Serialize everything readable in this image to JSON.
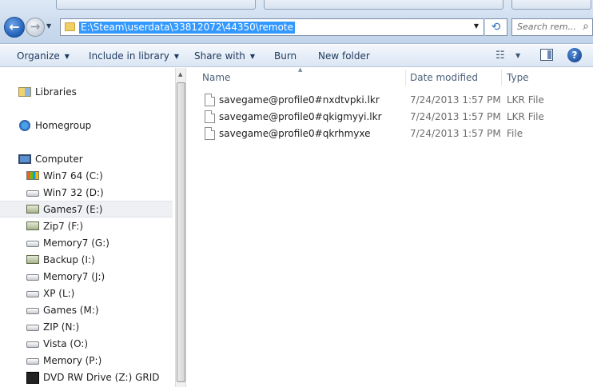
{
  "address_bar": {
    "path": "E:\\Steam\\userdata\\33812072\\44350\\remote",
    "search_placeholder": "Search rem...",
    "back_glyph": "←",
    "forward_glyph": "→",
    "refresh_glyph": "⟲",
    "search_glyph": "⌕"
  },
  "toolbar": {
    "organize_label": "Organize",
    "include_label": "Include in library",
    "share_label": "Share with",
    "burn_label": "Burn",
    "new_folder_label": "New folder",
    "caret_glyph": "▼",
    "views_glyph": "☷",
    "help_glyph": "?"
  },
  "navigation": {
    "items": [
      {
        "label": "Libraries",
        "icon": "libraries-icon"
      },
      {
        "label": "Homegroup",
        "icon": "homegroup-icon"
      },
      {
        "label": "Computer",
        "icon": "computer-icon"
      },
      {
        "label": "Win7 64 (C:)",
        "icon": "windows-drive-icon"
      },
      {
        "label": "Win7 32 (D:)",
        "icon": "drive-icon"
      },
      {
        "label": "Games7 (E:)",
        "icon": "external-drive-icon",
        "selected": true
      },
      {
        "label": "Zip7 (F:)",
        "icon": "external-drive-icon"
      },
      {
        "label": "Memory7 (G:)",
        "icon": "drive-icon"
      },
      {
        "label": "Backup (I:)",
        "icon": "external-drive-icon"
      },
      {
        "label": "Memory7 (J:)",
        "icon": "drive-icon"
      },
      {
        "label": "XP (L:)",
        "icon": "drive-icon"
      },
      {
        "label": "Games (M:)",
        "icon": "drive-icon"
      },
      {
        "label": "ZIP (N:)",
        "icon": "drive-icon"
      },
      {
        "label": "Vista (O:)",
        "icon": "drive-icon"
      },
      {
        "label": "Memory (P:)",
        "icon": "drive-icon"
      },
      {
        "label": "DVD RW Drive (Z:) GRID",
        "icon": "dvd-drive-icon"
      }
    ]
  },
  "file_list": {
    "columns": {
      "name": "Name",
      "date": "Date modified",
      "type": "Type"
    },
    "files": [
      {
        "name": "savegame@profile0#nxdtvpki.lkr",
        "date": "7/24/2013 1:57 PM",
        "type": "LKR File"
      },
      {
        "name": "savegame@profile0#qkigmyyi.lkr",
        "date": "7/24/2013 1:57 PM",
        "type": "LKR File"
      },
      {
        "name": "savegame@profile0#qkrhmyxe",
        "date": "7/24/2013 1:57 PM",
        "type": "File"
      }
    ]
  },
  "colors": {
    "selection": "#3399ff",
    "header_text": "#4c607a",
    "toolbar_text": "#1e395b"
  }
}
